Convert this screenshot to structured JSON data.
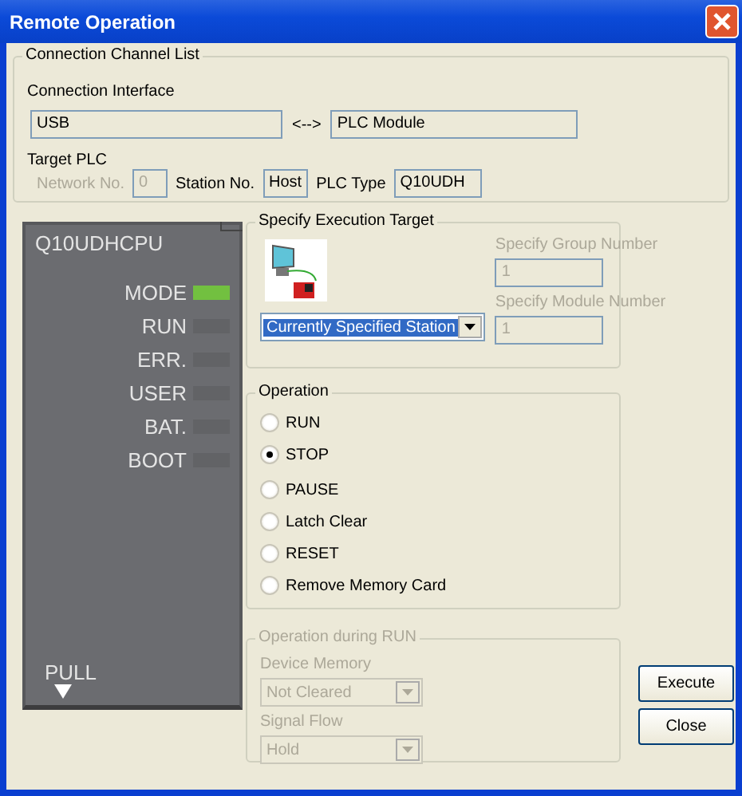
{
  "window": {
    "title": "Remote Operation"
  },
  "connection_channel_list": {
    "title": "Connection Channel List",
    "interface_label": "Connection Interface",
    "interface": "USB",
    "arrow": "<-->",
    "target": "PLC Module",
    "target_plc_label": "Target PLC",
    "fields": [
      {
        "label": "Network No.",
        "value": "0",
        "disabled": true
      },
      {
        "label": "Station No.",
        "value": "Host",
        "disabled": false
      },
      {
        "label": "PLC Type",
        "value": "Q10UDH",
        "disabled": false
      }
    ]
  },
  "cpu_module": {
    "model": "Q10UDHCPU",
    "pull_label": "PULL",
    "leds": [
      {
        "label": "MODE",
        "lit": true
      },
      {
        "label": "RUN",
        "lit": false
      },
      {
        "label": "ERR.",
        "lit": false
      },
      {
        "label": "USER",
        "lit": false
      },
      {
        "label": "BAT.",
        "lit": false
      },
      {
        "label": "BOOT",
        "lit": false
      }
    ]
  },
  "execution_target": {
    "title": "Specify Execution Target",
    "target": "Currently Specified Station",
    "numbers": [
      {
        "label": "Specify Group Number",
        "value": "1",
        "disabled": true
      },
      {
        "label": "Specify Module Number",
        "value": "1",
        "disabled": true
      }
    ]
  },
  "operation": {
    "title": "Operation",
    "options": [
      {
        "label": "RUN",
        "selected": false
      },
      {
        "label": "STOP",
        "selected": true
      },
      {
        "label": "PAUSE",
        "selected": false
      },
      {
        "label": "Latch Clear",
        "selected": false
      },
      {
        "label": "RESET",
        "selected": false
      },
      {
        "label": "Remove Memory Card",
        "selected": false
      }
    ]
  },
  "operation_during_run": {
    "title": "Operation during RUN",
    "disabled": true,
    "selects": [
      {
        "label": "Device Memory",
        "value": "Not Cleared"
      },
      {
        "label": "Signal Flow",
        "value": "Hold"
      }
    ]
  },
  "buttons": [
    "Execute",
    "Close"
  ]
}
